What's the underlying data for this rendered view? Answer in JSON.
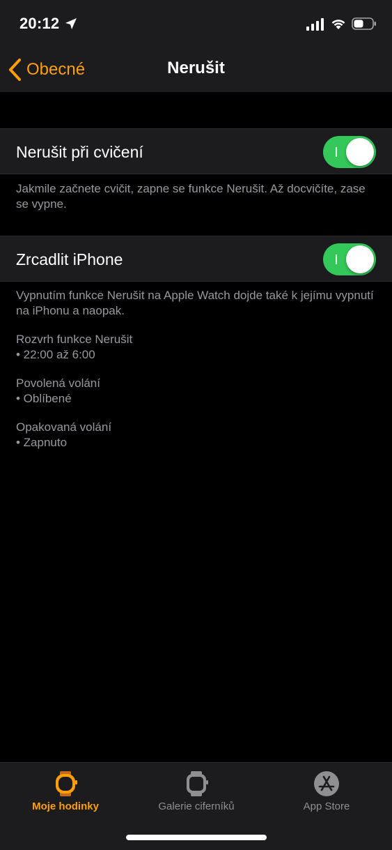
{
  "status_bar": {
    "time": "20:12"
  },
  "nav": {
    "back_label": "Obecné",
    "title": "Nerušit"
  },
  "settings": {
    "workout": {
      "label": "Nerušit při cvičení",
      "enabled": true,
      "footer": "Jakmile začnete cvičit, zapne se funkce Nerušit. Až docvičíte, zase se vypne."
    },
    "mirror": {
      "label": "Zrcadlit iPhone",
      "enabled": true,
      "footer": "Vypnutím funkce Nerušit na Apple Watch dojde také k jejímu vypnutí na iPhonu a naopak."
    }
  },
  "info": [
    {
      "title": "Rozvrh funkce Nerušit",
      "value": "• 22:00 až 6:00"
    },
    {
      "title": "Povolená volání",
      "value": "• Oblíbené"
    },
    {
      "title": "Opakovaná volání",
      "value": "• Zapnuto"
    }
  ],
  "tabs": [
    {
      "label": "Moje hodinky",
      "icon": "watch-icon",
      "active": true
    },
    {
      "label": "Galerie ciferníků",
      "icon": "watch-face-gallery-icon",
      "active": false
    },
    {
      "label": "App Store",
      "icon": "app-store-icon",
      "active": false
    }
  ],
  "colors": {
    "accent": "#ff9f0a",
    "toggle_on": "#34c759",
    "background": "#000000",
    "cell_background": "#1c1c1e",
    "secondary_text": "#98989f"
  }
}
